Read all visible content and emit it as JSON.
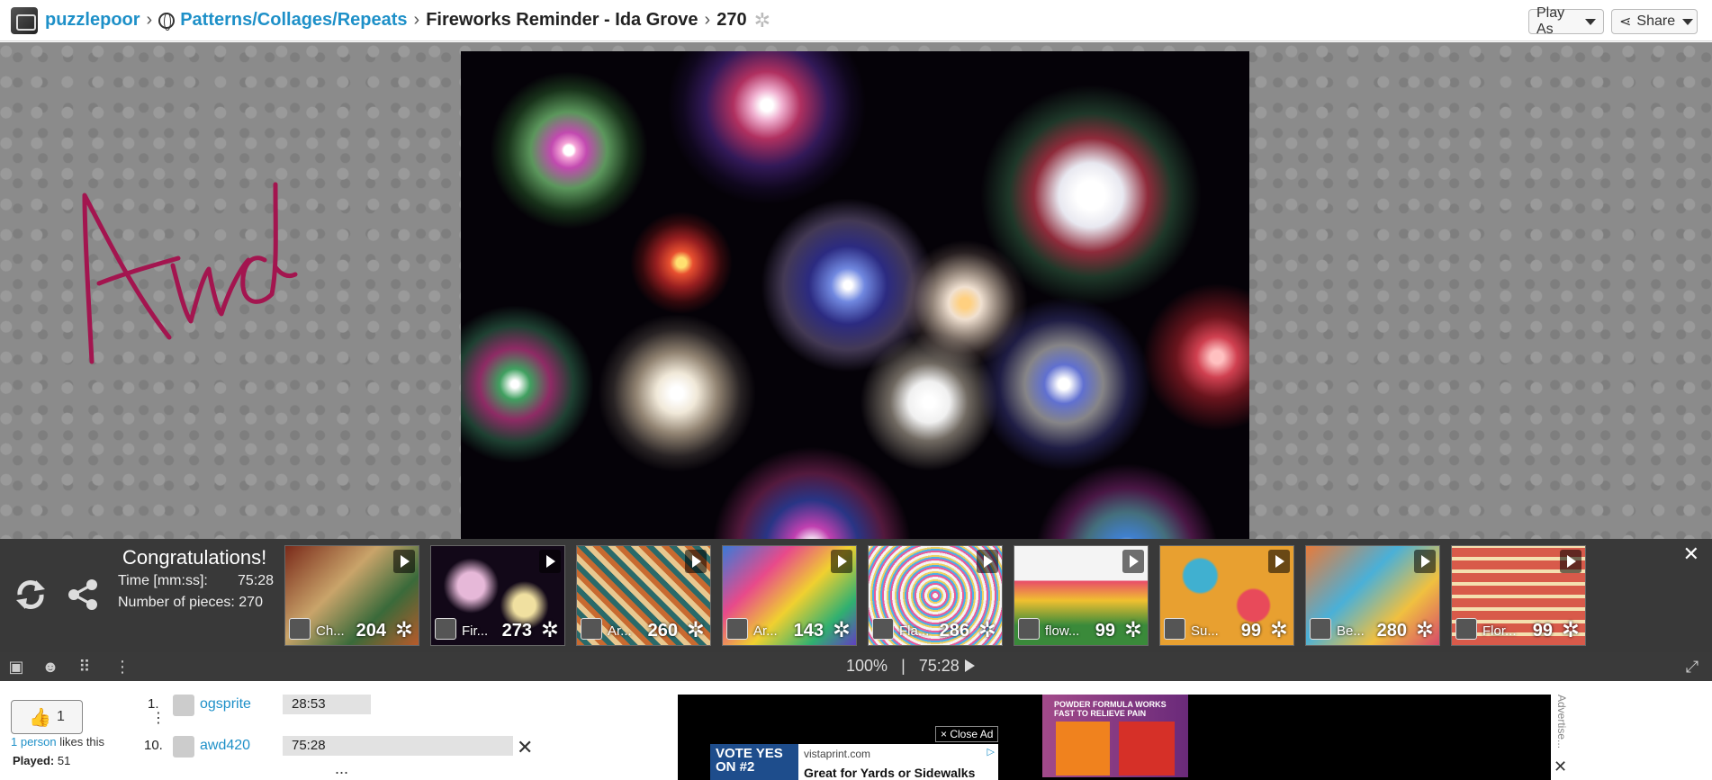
{
  "header": {
    "username": "puzzlepoor",
    "category": "Patterns/Collages/Repeats",
    "title": "Fireworks Reminder - Ida Grove",
    "pieces": "270",
    "play_as_label": "Play As",
    "share_label": "Share"
  },
  "stage": {
    "signature_text": "Awd"
  },
  "congrats": {
    "title": "Congratulations!",
    "time_label": "Time [mm:ss]:",
    "time_value": "75:28",
    "pieces_label": "Number of pieces: 270",
    "close": "✕"
  },
  "thumbnails": [
    {
      "name": "Ch...",
      "count": "204",
      "bg": "linear-gradient(135deg,#7a2a1a,#c9a46a 40%,#3a6a3a 70%,#b85a2a)"
    },
    {
      "name": "Fir...",
      "count": "273",
      "bg": "radial-gradient(circle at 30% 40%,#e6b8d8 0 12%,transparent 25%),radial-gradient(circle at 70% 60%,#f0e0a0 0 10%,transparent 22%),#120818"
    },
    {
      "name": "Ar...",
      "count": "260",
      "bg": "repeating-linear-gradient(45deg,#c86a30 0 6px,#2a6a6a 6px 12px,#e8c890 12px 18px)"
    },
    {
      "name": "Ar...",
      "count": "143",
      "bg": "linear-gradient(135deg,#3a7ad8,#e84a8a 30%,#f0d030 55%,#30b070 80%,#6040c0)"
    },
    {
      "name": "Fla...",
      "count": "286",
      "bg": "repeating-radial-gradient(circle at 50% 50%,#f4f4f4 0 3px,#e85a9a 3px 5px,#4ab0e8 5px 7px,#f0d060 7px 9px)"
    },
    {
      "name": "flow...",
      "count": "99",
      "bg": "linear-gradient(180deg,#f4f4f4 0 35%,#e84a6a 35%,#f0c030 55%,#3a8a3a 80%)"
    },
    {
      "name": "Su...",
      "count": "99",
      "bg": "radial-gradient(circle at 30% 30%,#40b0d0 0 14%,transparent 16%),radial-gradient(circle at 70% 60%,#e84a5a 0 14%,transparent 16%),#e8a030"
    },
    {
      "name": "Be...",
      "count": "280",
      "bg": "linear-gradient(135deg,#e87a3a,#4ab0d8 40%,#f0c040 70%,#d84a6a)"
    },
    {
      "name": "Flor...",
      "count": "99",
      "bg": "repeating-linear-gradient(0deg,#d85a4a 0 10px,#f4e0b0 10px 14px),#d85a4a"
    }
  ],
  "statusbar": {
    "zoom": "100%",
    "separator": "|",
    "time": "75:28"
  },
  "social": {
    "like_count": "1",
    "likes_link": "1 person",
    "likes_suffix": " likes this",
    "played_label": "Played:",
    "played_value": "51"
  },
  "leaderboard": [
    {
      "rank": "1.",
      "name": "ogsprite",
      "time": "28:53"
    },
    {
      "rank": "10.",
      "name": "awd420",
      "time": "75:28"
    }
  ],
  "leaderboard_more": "...",
  "ad": {
    "close_label": "× Close Ad",
    "vote_text": "VOTE YES ON #2",
    "site": "vistaprint.com",
    "headline": "Great for Yards or Sidewalks",
    "product_text": "POWDER FORMULA WORKS FAST TO RELIEVE PAIN",
    "side_label": "Advertise..."
  },
  "colors": {
    "link": "#1e90c8",
    "signature": "#a3154f"
  }
}
